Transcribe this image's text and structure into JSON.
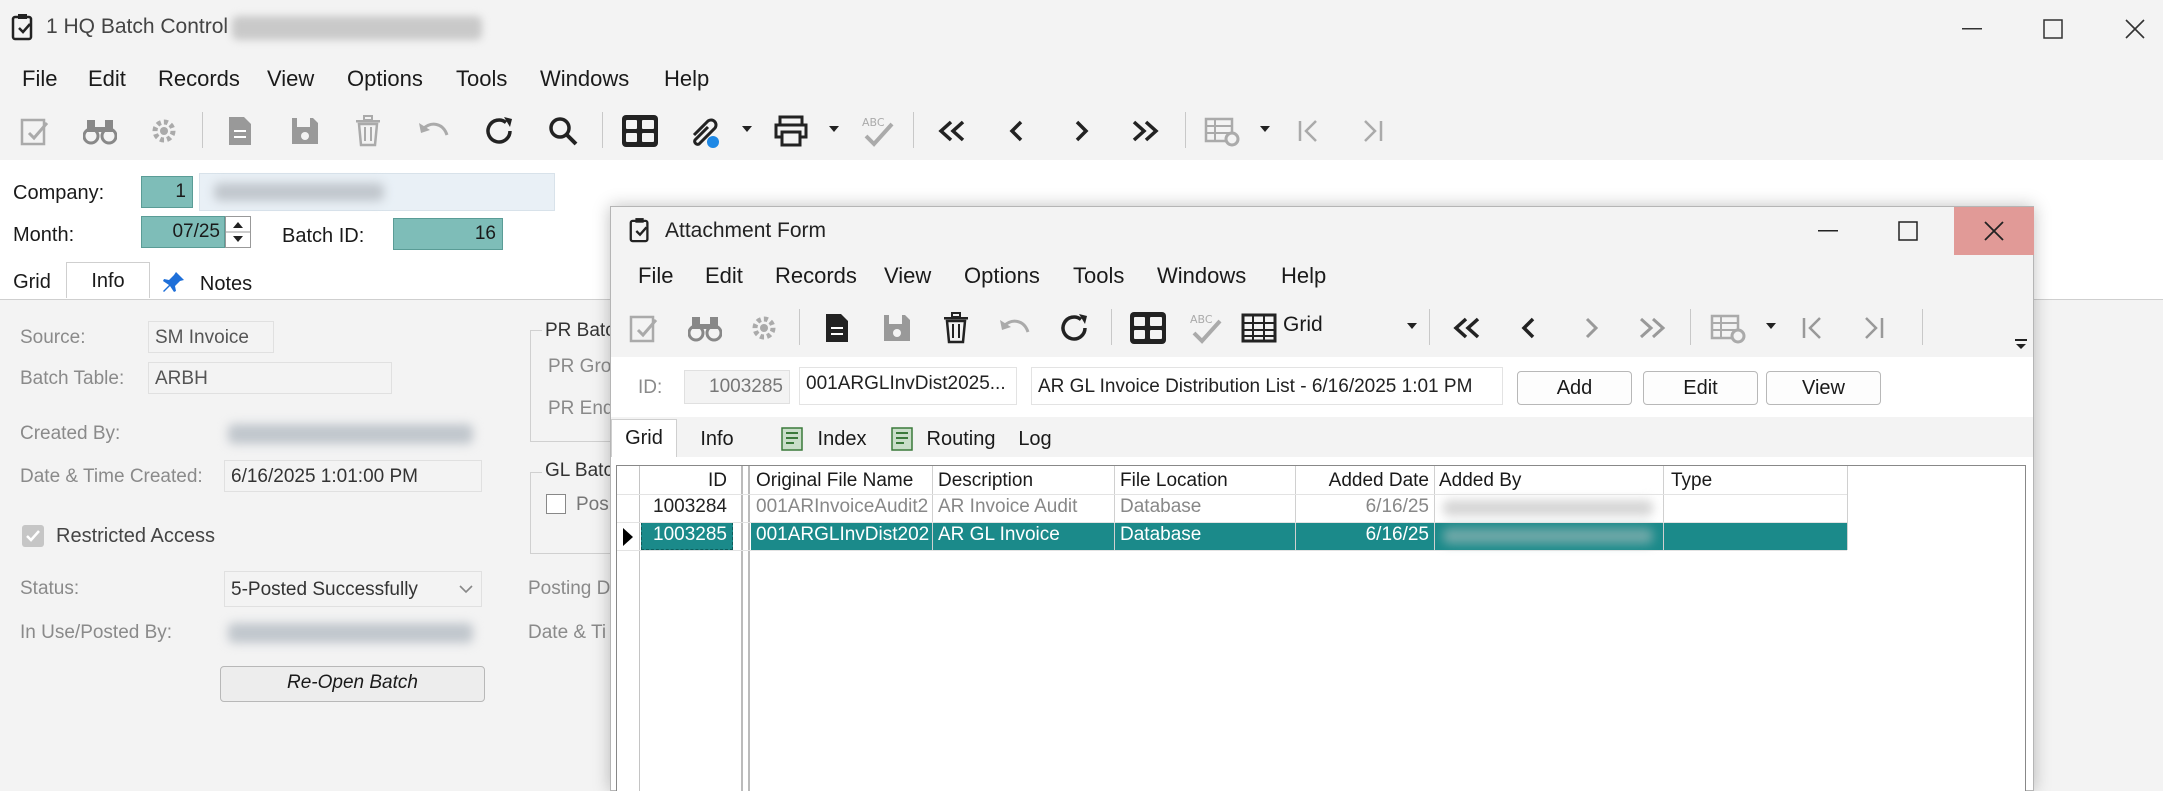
{
  "main": {
    "title": "1 HQ Batch Control",
    "menu": [
      "File",
      "Edit",
      "Records",
      "View",
      "Options",
      "Tools",
      "Windows",
      "Help"
    ],
    "company_label": "Company:",
    "company_value": "1",
    "month_label": "Month:",
    "month_value": "07/25",
    "batch_id_label": "Batch ID:",
    "batch_id_value": "16",
    "tabs": [
      "Grid",
      "Info",
      "Notes"
    ],
    "info": {
      "source_label": "Source:",
      "source_value": "SM Invoice",
      "batch_table_label": "Batch Table:",
      "batch_table_value": "ARBH",
      "created_by_label": "Created By:",
      "date_time_created_label": "Date & Time Created:",
      "date_time_created_value": "6/16/2025 1:01:00 PM",
      "restricted_access_label": "Restricted Access",
      "status_label": "Status:",
      "status_value": "5-Posted Successfully",
      "in_use_label": "In Use/Posted By:",
      "reopen_button": "Re-Open Batch",
      "pr_batch_title": "PR Batc",
      "pr_group_label": "PR Gro",
      "pr_end_label": "PR End",
      "gl_batch_title": "GL Batc",
      "gl_posted_label": "Pos",
      "posting_date_label": "Posting D",
      "date_ti_label": "Date & Ti"
    }
  },
  "attachment": {
    "title": "Attachment Form",
    "menu": [
      "File",
      "Edit",
      "Records",
      "View",
      "Options",
      "Tools",
      "Windows",
      "Help"
    ],
    "grid_view_label": "Grid",
    "id_label": "ID:",
    "id_value": "1003285",
    "file_name_value": "001ARGLInvDist2025...",
    "description_value": "AR GL Invoice Distribution List - 6/16/2025 1:01 PM",
    "add_button": "Add",
    "edit_button": "Edit",
    "view_button": "View",
    "tabs": [
      "Grid",
      "Info",
      "Index",
      "Routing",
      "Log"
    ],
    "grid": {
      "columns": [
        "ID",
        "Original File Name",
        "Description",
        "File Location",
        "Added Date",
        "Added By",
        "Type"
      ],
      "rows": [
        {
          "id": "1003284",
          "file": "001ARInvoiceAudit2",
          "desc": "AR Invoice Audit",
          "loc": "Database",
          "date": "6/16/25",
          "type": ""
        },
        {
          "id": "1003285",
          "file": "001ARGLInvDist202",
          "desc": "AR GL Invoice",
          "loc": "Database",
          "date": "6/16/25",
          "type": ""
        }
      ]
    }
  },
  "colors": {
    "accent_teal": "#1b8a8a",
    "field_teal": "#7ebdb8",
    "close_red": "#e19a97"
  }
}
